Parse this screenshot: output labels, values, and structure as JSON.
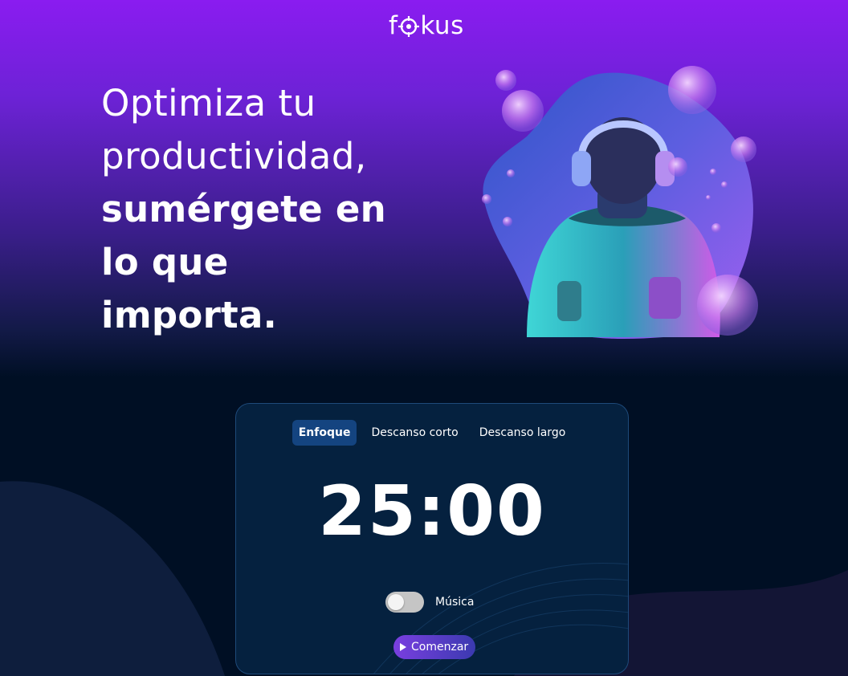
{
  "brand": {
    "logo_left": "f",
    "logo_right": "kus",
    "logo_icon": "target-icon"
  },
  "hero": {
    "line1": "Optimiza tu",
    "line2": "productividad,",
    "line3": "sumérgete en",
    "line4": "lo que",
    "line5": "importa."
  },
  "illustration": {
    "icon": "person-with-headphones-illustration"
  },
  "timer": {
    "tabs": [
      {
        "label": "Enfoque",
        "active": true
      },
      {
        "label": "Descanso corto",
        "active": false
      },
      {
        "label": "Descanso largo",
        "active": false
      }
    ],
    "time": "25:00",
    "music_label": "Música",
    "music_on": false,
    "start_label": "Comenzar",
    "start_icon": "play-icon"
  },
  "colors": {
    "background_top": "#8a1cf0",
    "background_bottom": "#000f24",
    "card_bg": "#05213f",
    "active_tab_bg": "#144480",
    "button_gradient_start": "#7a3fe0",
    "button_gradient_end": "#3b3ab0"
  }
}
